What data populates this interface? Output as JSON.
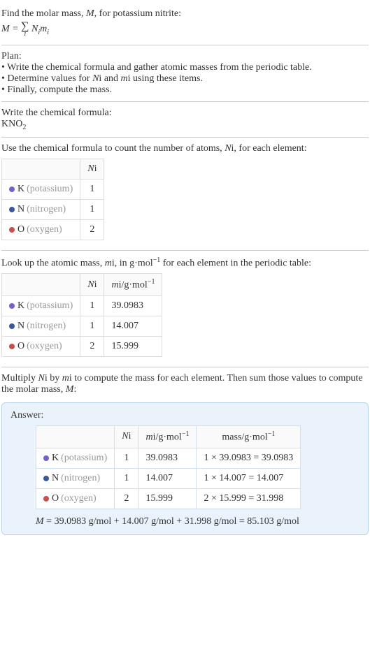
{
  "intro": {
    "line1_prefix": "Find the molar mass, ",
    "line1_var": "M",
    "line1_suffix": ", for potassium nitrite:",
    "formula_lhs": "M",
    "formula_eq": " = ",
    "formula_sigma": "∑",
    "formula_index": "i",
    "formula_N": "N",
    "formula_m": "m"
  },
  "plan": {
    "title": "Plan:",
    "item1_prefix": "• Write the chemical formula and gather atomic masses from the periodic table.",
    "item2_prefix": "• Determine values for ",
    "item2_N": "N",
    "item2_mid": " and ",
    "item2_m": "m",
    "item2_suffix": " using these items.",
    "item3": "• Finally, compute the mass."
  },
  "chemformula": {
    "title": "Write the chemical formula:",
    "formula_main": "KNO",
    "formula_sub": "2"
  },
  "count": {
    "title_prefix": "Use the chemical formula to count the number of atoms, ",
    "title_var": "N",
    "title_suffix": ", for each element:",
    "header_N": "N",
    "rows": [
      {
        "dot": "dot-k",
        "sym": "K",
        "name": "(potassium)",
        "n": "1"
      },
      {
        "dot": "dot-n",
        "sym": "N",
        "name": "(nitrogen)",
        "n": "1"
      },
      {
        "dot": "dot-o",
        "sym": "O",
        "name": "(oxygen)",
        "n": "2"
      }
    ]
  },
  "atomic": {
    "title_prefix": "Look up the atomic mass, ",
    "title_var": "m",
    "title_mid": ", in g·mol",
    "title_exp": "−1",
    "title_suffix": " for each element in the periodic table:",
    "header_N": "N",
    "header_m": "m",
    "header_unit": "/g·mol",
    "header_exp": "−1",
    "rows": [
      {
        "dot": "dot-k",
        "sym": "K",
        "name": "(potassium)",
        "n": "1",
        "m": "39.0983"
      },
      {
        "dot": "dot-n",
        "sym": "N",
        "name": "(nitrogen)",
        "n": "1",
        "m": "14.007"
      },
      {
        "dot": "dot-o",
        "sym": "O",
        "name": "(oxygen)",
        "n": "2",
        "m": "15.999"
      }
    ]
  },
  "compute": {
    "line1_prefix": "Multiply ",
    "line1_N": "N",
    "line1_mid": " by ",
    "line1_m": "m",
    "line1_suffix": " to compute the mass for each element. Then sum those values to compute the molar mass, ",
    "line1_M": "M",
    "line1_end": ":"
  },
  "answer": {
    "label": "Answer:",
    "header_N": "N",
    "header_m": "m",
    "header_unit": "/g·mol",
    "header_exp": "−1",
    "header_mass": "mass/g·mol",
    "rows": [
      {
        "dot": "dot-k",
        "sym": "K",
        "name": "(potassium)",
        "n": "1",
        "m": "39.0983",
        "mass": "1 × 39.0983 = 39.0983"
      },
      {
        "dot": "dot-n",
        "sym": "N",
        "name": "(nitrogen)",
        "n": "1",
        "m": "14.007",
        "mass": "1 × 14.007 = 14.007"
      },
      {
        "dot": "dot-o",
        "sym": "O",
        "name": "(oxygen)",
        "n": "2",
        "m": "15.999",
        "mass": "2 × 15.999 = 31.998"
      }
    ],
    "final_M": "M",
    "final_text": " = 39.0983 g/mol + 14.007 g/mol + 31.998 g/mol = 85.103 g/mol"
  },
  "sub_i": "i"
}
